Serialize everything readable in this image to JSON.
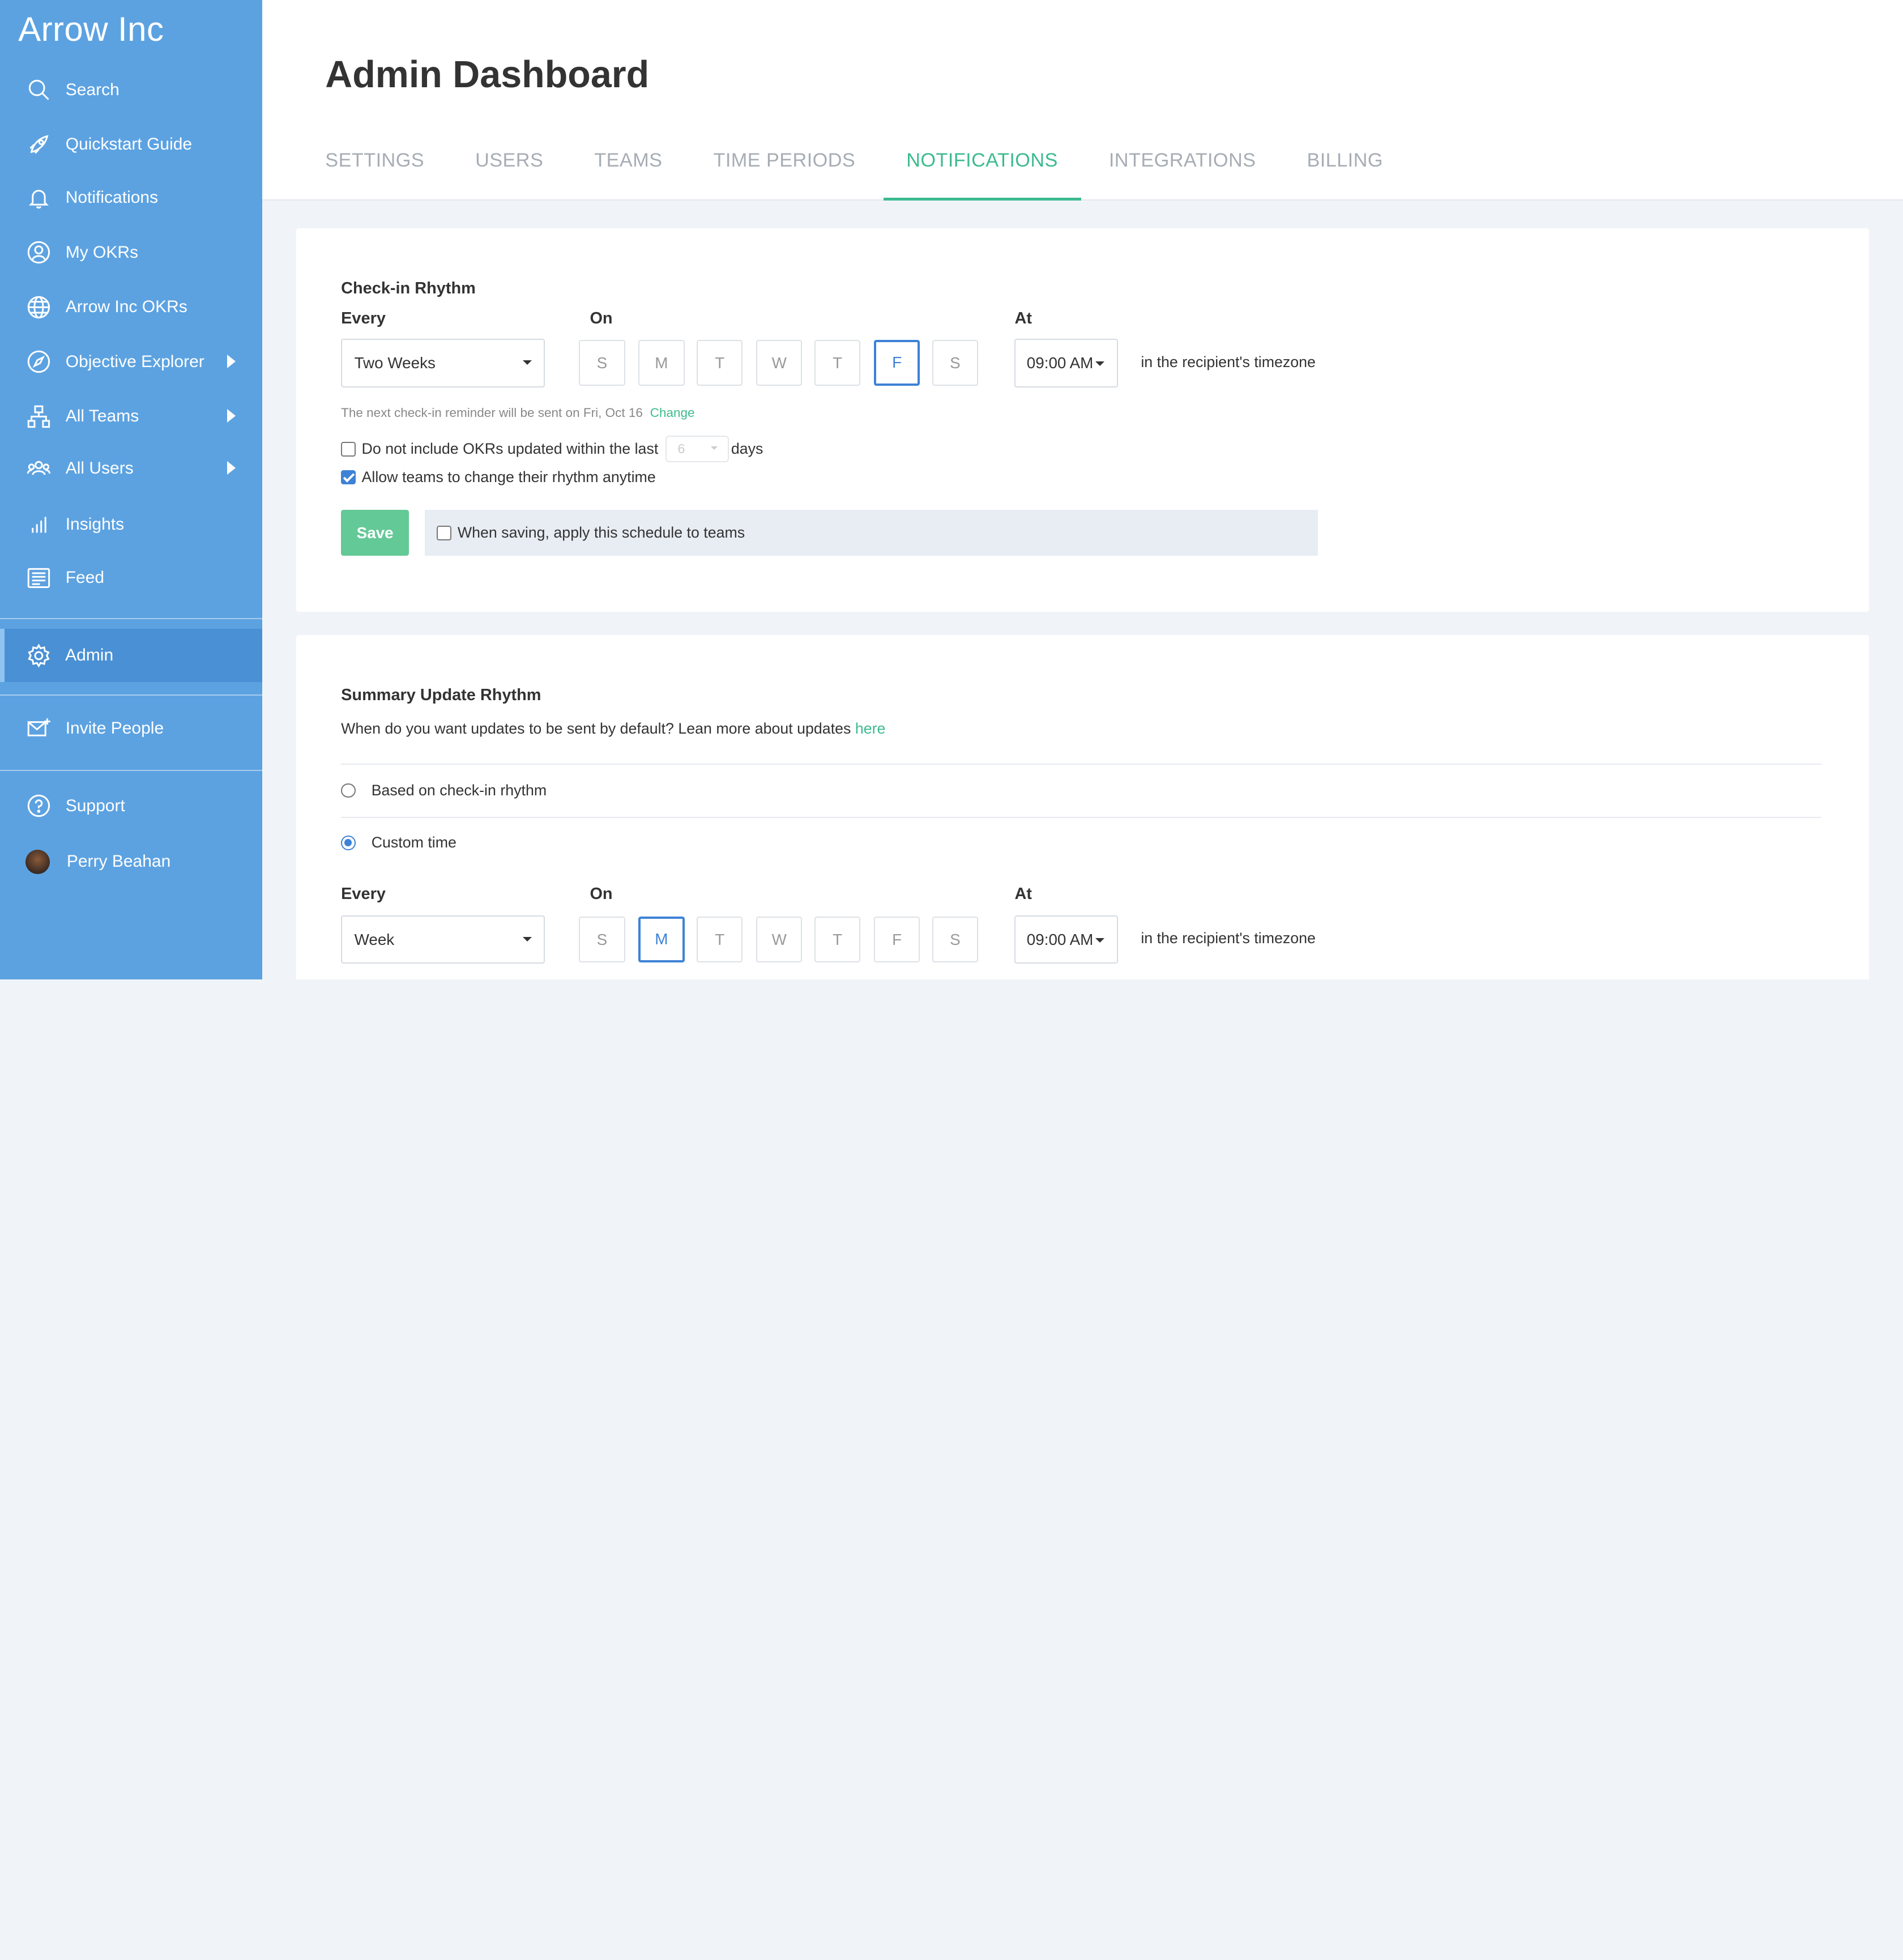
{
  "sidebar": {
    "brand": "Arrow Inc",
    "items": [
      {
        "label": "Search"
      },
      {
        "label": "Quickstart Guide"
      },
      {
        "label": "Notifications"
      },
      {
        "label": "My OKRs"
      },
      {
        "label": "Arrow Inc OKRs"
      },
      {
        "label": "Objective Explorer"
      },
      {
        "label": "All Teams"
      },
      {
        "label": "All Users"
      },
      {
        "label": "Insights"
      },
      {
        "label": "Feed"
      },
      {
        "label": "Admin"
      },
      {
        "label": "Invite People"
      },
      {
        "label": "Support"
      },
      {
        "label": "Perry Beahan"
      }
    ]
  },
  "header": {
    "title": "Admin Dashboard",
    "tabs": [
      {
        "label": "SETTINGS"
      },
      {
        "label": "USERS"
      },
      {
        "label": "TEAMS"
      },
      {
        "label": "TIME PERIODS"
      },
      {
        "label": "NOTIFICATIONS"
      },
      {
        "label": "INTEGRATIONS"
      },
      {
        "label": "BILLING"
      }
    ],
    "active_tab": "NOTIFICATIONS"
  },
  "checkin": {
    "title": "Check-in Rhythm",
    "every_label": "Every",
    "on_label": "On",
    "at_label": "At",
    "every_value": "Two Weeks",
    "days": [
      "S",
      "M",
      "T",
      "W",
      "T",
      "F",
      "S"
    ],
    "selected_day": "F",
    "time_value": "09:00 AM",
    "timezone_text": "in the recipient's timezone",
    "next_reminder": "The next check-in reminder will be sent on Fri, Oct 16",
    "change_link": "Change",
    "exclude_label": "Do not include OKRs updated within the last",
    "exclude_days_value": "6",
    "exclude_days_unit": "days",
    "allow_teams_label": "Allow teams to change their rhythm anytime",
    "save_label": "Save",
    "apply_label": "When saving, apply this schedule to teams"
  },
  "summary": {
    "title": "Summary Update Rhythm",
    "description": "When do you want updates to be sent by default? Lean more about updates",
    "here_link": "here",
    "option_based": "Based on check-in rhythm",
    "option_custom": "Custom time",
    "every_label": "Every",
    "on_label": "On",
    "at_label": "At",
    "every_value": "Week",
    "days": [
      "S",
      "M",
      "T",
      "W",
      "T",
      "F",
      "S"
    ],
    "selected_day": "M",
    "time_value": "09:00 AM",
    "timezone_text": "in the recipient's timezone"
  },
  "colors": {
    "sidebar": "#5ca2e1",
    "accent_green": "#3dbb8e",
    "accent_blue": "#3d82d6"
  }
}
